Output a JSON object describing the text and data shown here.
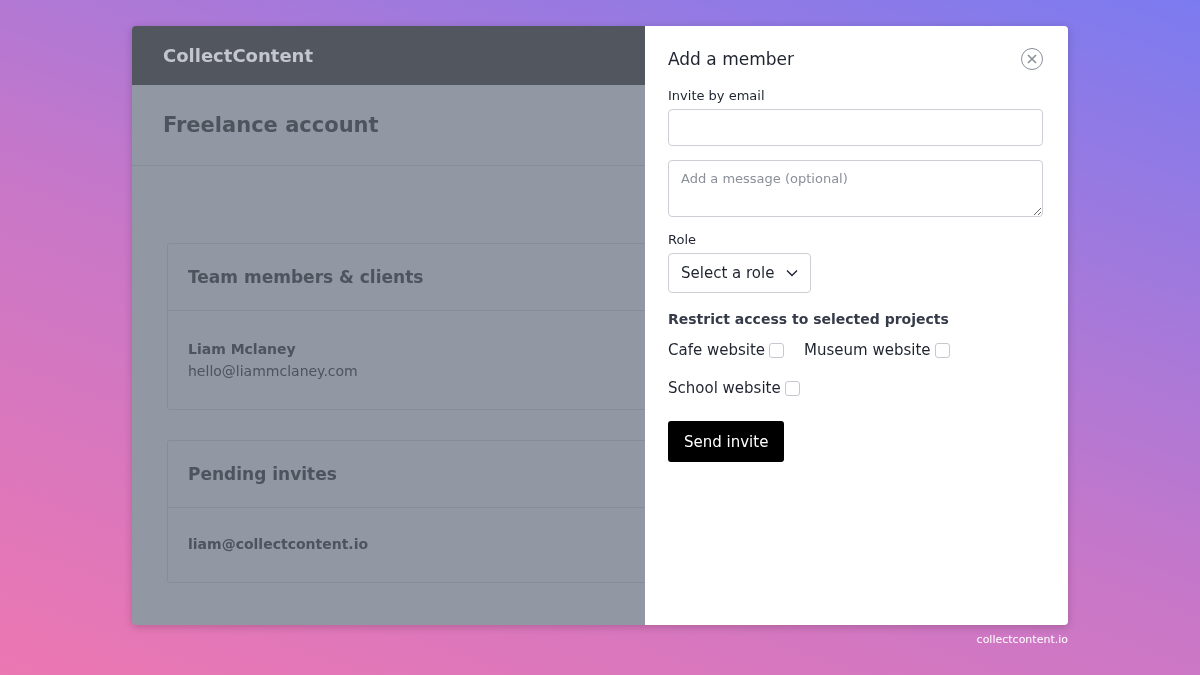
{
  "app": {
    "brand": "CollectContent",
    "page_title": "Freelance account",
    "sections": [
      {
        "title": "Team members & clients",
        "rows": [
          {
            "name": "Liam Mclaney",
            "email": "hello@liammclaney.com"
          }
        ]
      },
      {
        "title": "Pending invites",
        "rows": [
          {
            "email": "liam@collectcontent.io"
          }
        ]
      }
    ]
  },
  "dialog": {
    "title": "Add a member",
    "email_label": "Invite by email",
    "message": {
      "placeholder": "Add a message (optional)"
    },
    "role_label": "Role",
    "role_select": {
      "value": "Select a role"
    },
    "projects_heading": "Restrict access to selected projects",
    "projects": [
      {
        "label": "Cafe website",
        "checked": false
      },
      {
        "label": "Museum website",
        "checked": false
      },
      {
        "label": "School website",
        "checked": false
      }
    ],
    "submit": "Send invite"
  },
  "footer": "collectcontent.io"
}
